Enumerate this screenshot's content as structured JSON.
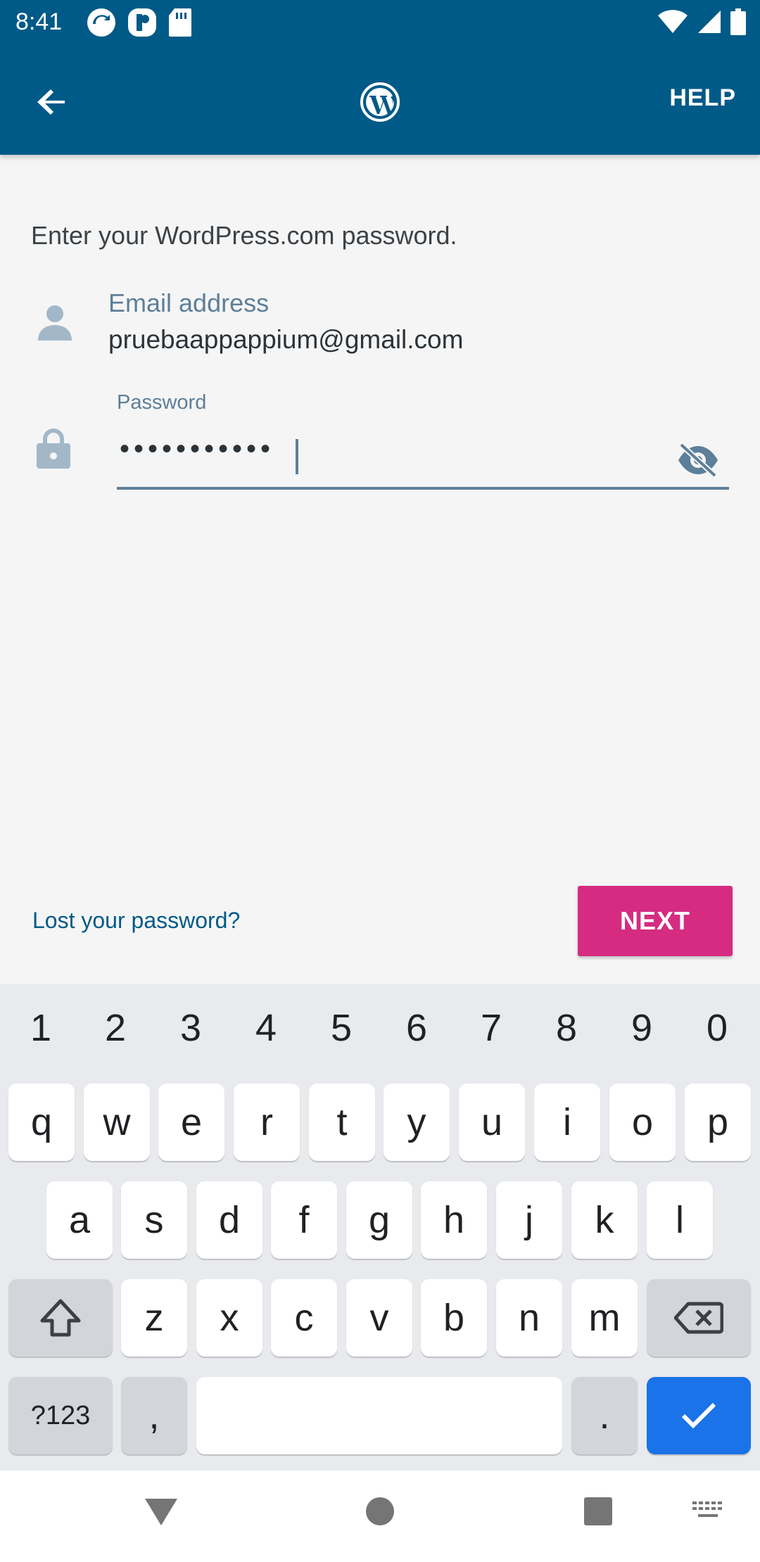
{
  "status_bar": {
    "time": "8:41",
    "left_icons": [
      "sync-icon",
      "app-icon",
      "sd-card-icon"
    ],
    "right_icons": [
      "wifi-icon",
      "signal-icon",
      "battery-icon"
    ]
  },
  "app_bar": {
    "back_icon": "arrow-left-icon",
    "logo_icon": "wordpress-logo",
    "help_label": "HELP",
    "bg_color": "#005a87"
  },
  "form": {
    "instruction": "Enter your WordPress.com password.",
    "email_label": "Email address",
    "email_value": "pruebaappappium@gmail.com",
    "password_label": "Password",
    "password_value": "•••••••••••",
    "password_visibility_icon": "eye-off-icon"
  },
  "actions": {
    "lost_password": "Lost your password?",
    "next_label": "NEXT",
    "next_color": "#d52c82"
  },
  "keyboard": {
    "number_row": [
      "1",
      "2",
      "3",
      "4",
      "5",
      "6",
      "7",
      "8",
      "9",
      "0"
    ],
    "row1": [
      "q",
      "w",
      "e",
      "r",
      "t",
      "y",
      "u",
      "i",
      "o",
      "p"
    ],
    "row2": [
      "a",
      "s",
      "d",
      "f",
      "g",
      "h",
      "j",
      "k",
      "l"
    ],
    "row3": [
      "z",
      "x",
      "c",
      "v",
      "b",
      "n",
      "m"
    ],
    "symbols_label": "?123",
    "comma": ",",
    "period": "."
  },
  "nav_bar": {
    "icons": [
      "back-triangle-icon",
      "home-circle-icon",
      "recents-square-icon",
      "keyboard-icon"
    ]
  }
}
